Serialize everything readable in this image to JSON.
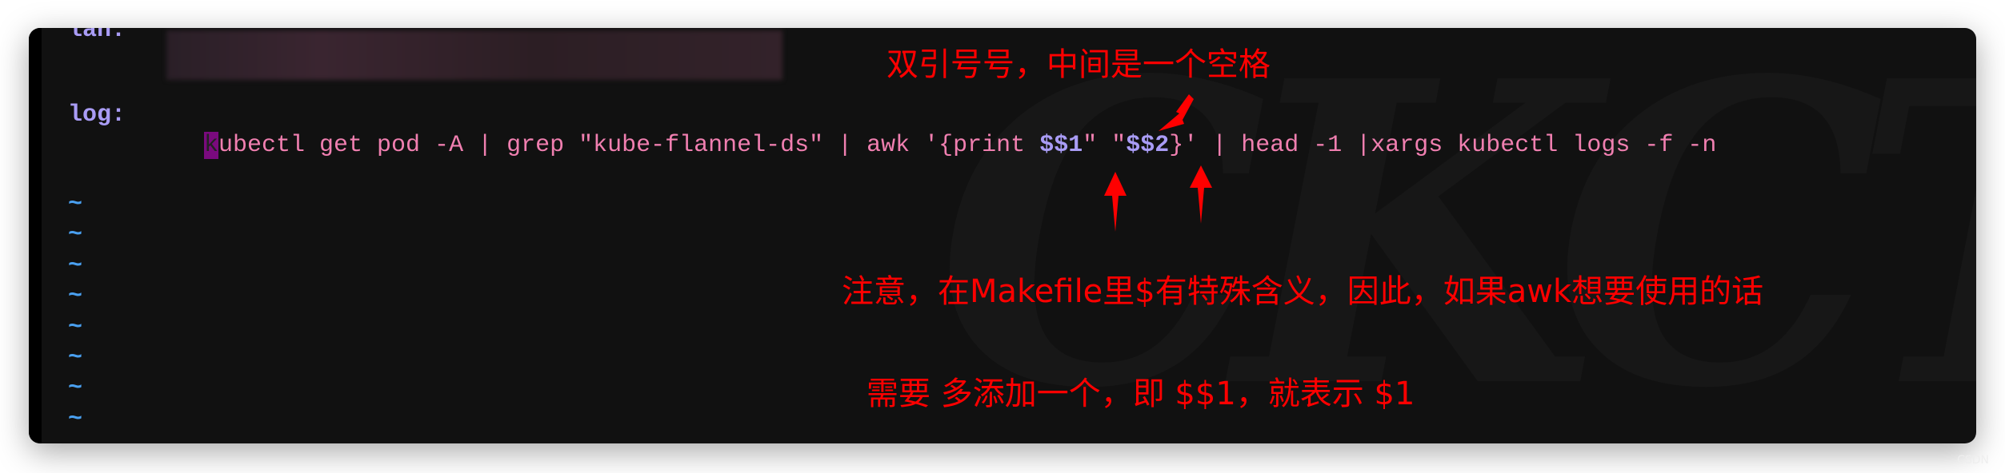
{
  "editor": {
    "prev_label": "lan:",
    "label": "log:",
    "cursor_char": "k",
    "command_parts": [
      {
        "text": "ubectl get pod -A | grep \"kube-flannel-ds\" | awk '{print ",
        "type": "text"
      },
      {
        "text": "$$1",
        "type": "var"
      },
      {
        "text": "\" \"",
        "type": "text"
      },
      {
        "text": "$$2",
        "type": "var"
      },
      {
        "text": "}' | head -1 |xargs kubectl logs -f -n",
        "type": "text"
      }
    ],
    "tilde": "~",
    "watermark": "CKCTeru"
  },
  "annotations": {
    "quote_note": "双引号号，中间是一个空格",
    "makefile_note": "注意，在Makefile里$有特殊含义，因此，如果awk想要使用的话",
    "double_dollar_note": "需要 多添加一个，即 $$1，就表示 $1"
  },
  "colors": {
    "annotation": "#ff0000",
    "label": "#a99cf5",
    "command": "#f07fb0",
    "tilde": "#4aa0f0",
    "background": "#111111"
  }
}
